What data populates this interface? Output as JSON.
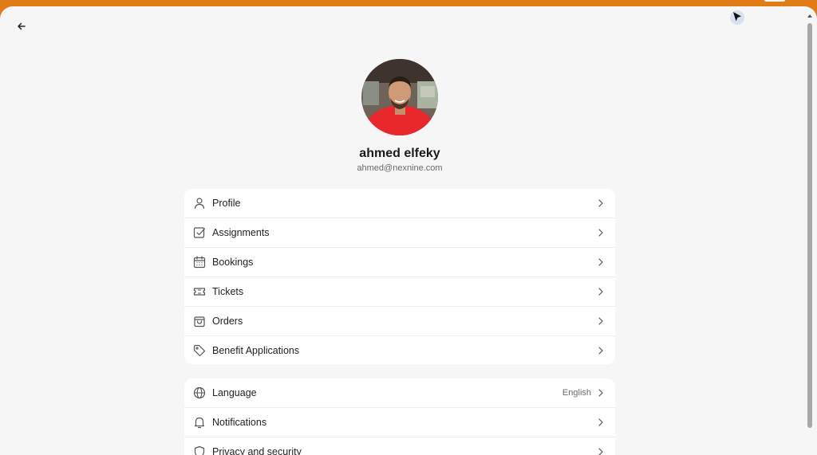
{
  "user": {
    "name": "ahmed elfeky",
    "email": "ahmed@nexnine.com"
  },
  "menu_primary": [
    {
      "label": "Profile",
      "icon": "user-icon"
    },
    {
      "label": "Assignments",
      "icon": "checkbox-icon"
    },
    {
      "label": "Bookings",
      "icon": "calendar-icon"
    },
    {
      "label": "Tickets",
      "icon": "ticket-icon"
    },
    {
      "label": "Orders",
      "icon": "shopping-bag-icon"
    },
    {
      "label": "Benefit Applications",
      "icon": "tag-icon"
    }
  ],
  "menu_secondary": [
    {
      "label": "Language",
      "value": "English",
      "icon": "globe-icon"
    },
    {
      "label": "Notifications",
      "icon": "bell-icon"
    },
    {
      "label": "Privacy and security",
      "icon": "shield-icon"
    }
  ],
  "colors": {
    "accent": "#e07b18",
    "background": "#f6f6f6",
    "card": "#ffffff",
    "avatar_shirt": "#e8282a"
  }
}
